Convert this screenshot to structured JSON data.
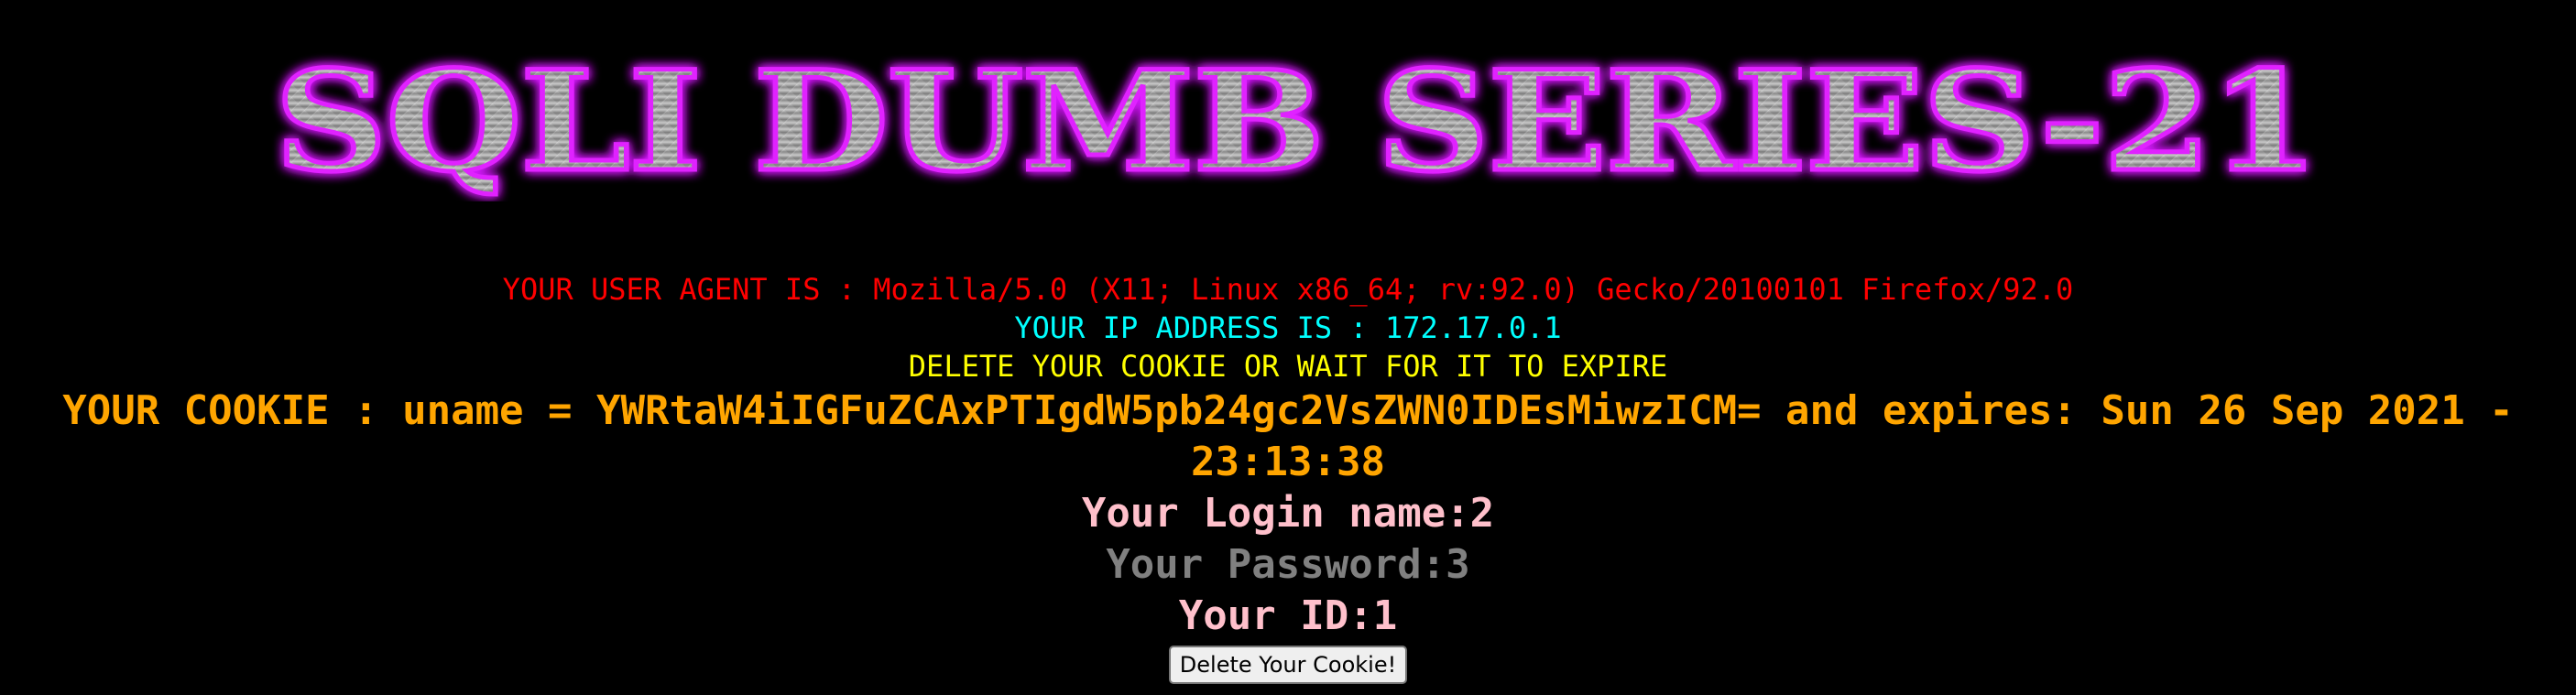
{
  "banner": {
    "title": "SQLI DUMB SERIES-21",
    "glow_color": "#d71aff",
    "metal_color": "#9a9a9a"
  },
  "info": {
    "user_agent": "YOUR USER AGENT IS : Mozilla/5.0 (X11; Linux x86_64; rv:92.0) Gecko/20100101 Firefox/92.0",
    "ip_address": "YOUR IP ADDRESS IS : 172.17.0.1",
    "cookie_warning": "DELETE YOUR COOKIE OR WAIT FOR IT TO EXPIRE",
    "cookie": "YOUR COOKIE : uname = YWRtaW4iIGFuZCAxPTIgdW5pb24gc2VsZWN0IDEsMiwzICM= and expires: Sun 26 Sep 2021 - 23:13:38",
    "login_name": "Your Login name:2",
    "password": "Your Password:3",
    "id": "Your ID:1"
  },
  "actions": {
    "delete_cookie_label": "Delete Your Cookie!"
  },
  "colors": {
    "background": "#000000",
    "user_agent": "#ff0000",
    "ip": "#00ffff",
    "warning": "#ffff00",
    "cookie": "#ffa500",
    "login": "#ffc0cb",
    "password": "#808080",
    "id": "#ffc0cb"
  }
}
